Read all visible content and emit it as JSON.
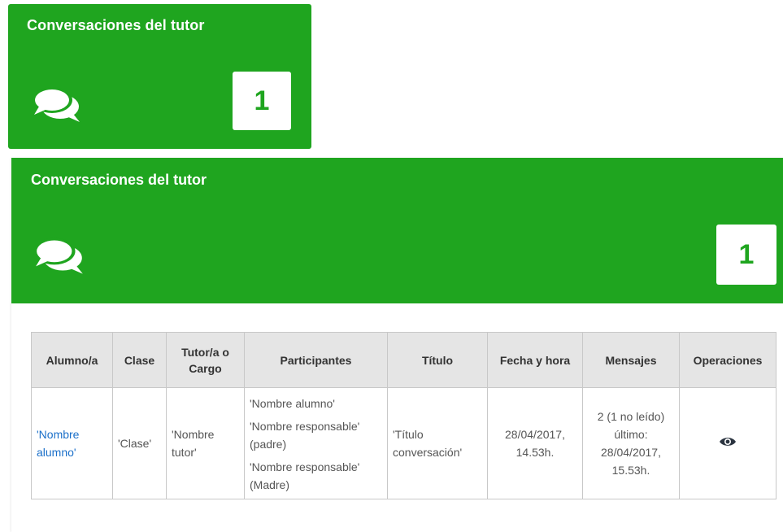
{
  "tile": {
    "title": "Conversaciones del tutor",
    "count": "1",
    "icon": "comments-icon"
  },
  "panel": {
    "title": "Conversaciones del tutor",
    "count": "1",
    "icon": "comments-icon"
  },
  "table": {
    "headers": {
      "alumno": "Alumno/a",
      "clase": "Clase",
      "tutor": "Tutor/a o Cargo",
      "participantes": "Participantes",
      "titulo": "Título",
      "fecha": "Fecha y hora",
      "mensajes": "Mensajes",
      "operaciones": "Operaciones"
    },
    "rows": [
      {
        "alumno": "'Nombre alumno'",
        "clase": "'Clase'",
        "tutor": "'Nombre tutor'",
        "participantes": [
          "'Nombre alumno'",
          "'Nombre responsable' (padre)",
          "'Nombre responsable' (Madre)"
        ],
        "titulo": "'Título conversación'",
        "fecha": "28/04/2017, 14.53h.",
        "mensajes": "2 (1 no leído) último: 28/04/2017, 15.53h.",
        "operacion_icon": "eye-icon"
      }
    ]
  },
  "colors": {
    "accent": "#1fa51f",
    "link": "#1a6fc9",
    "header_bg": "#e5e5e5"
  }
}
